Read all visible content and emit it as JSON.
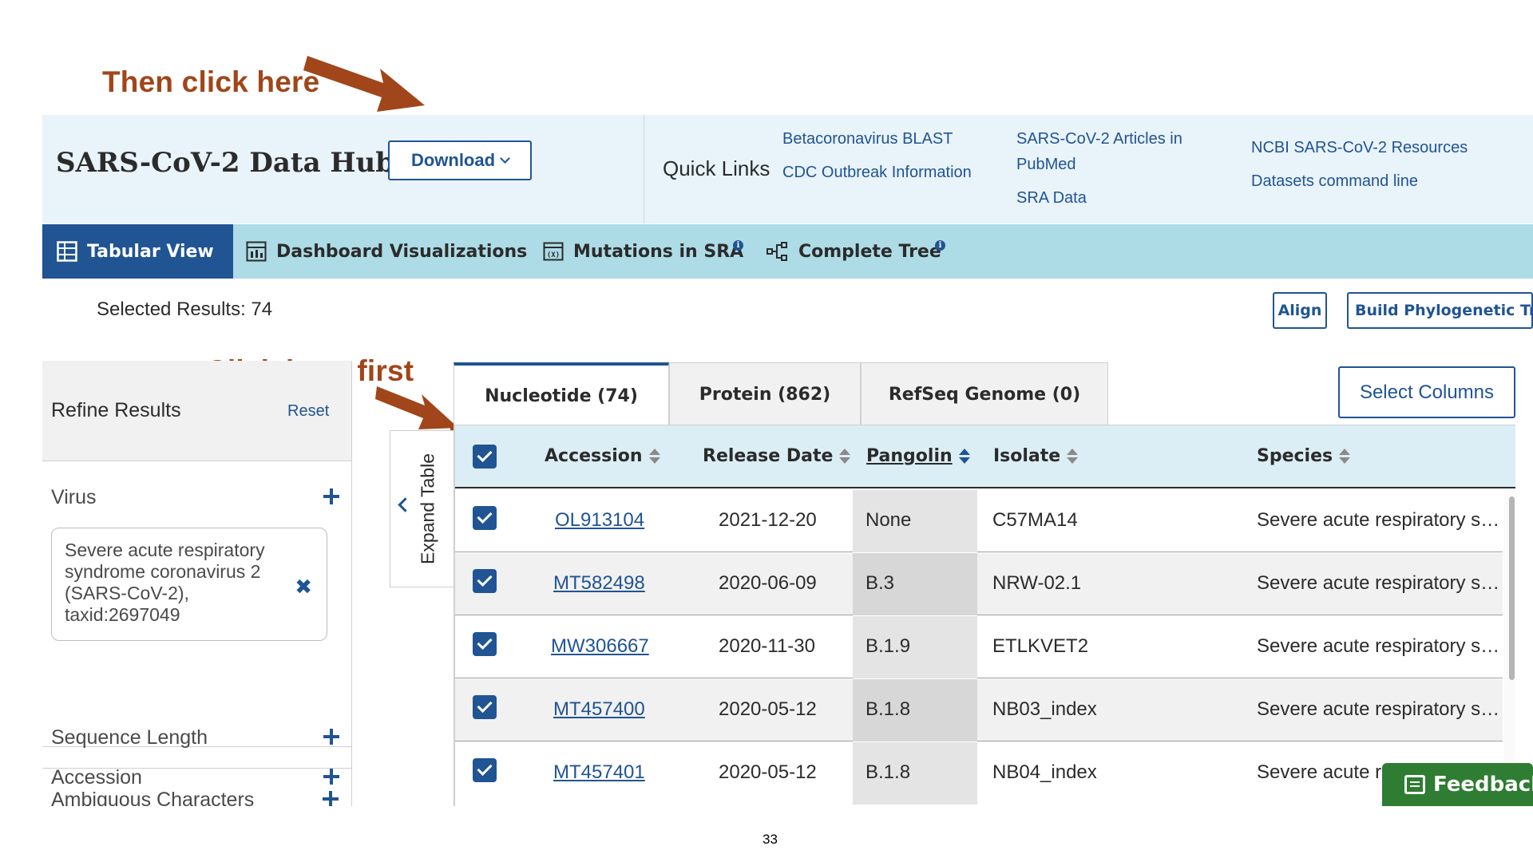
{
  "annotations": {
    "top": "Then click here",
    "left": "Click here first"
  },
  "header": {
    "title": "SARS-CoV-2 Data Hub",
    "download_label": "Download",
    "quick_links_label": "Quick Links",
    "quick_links": [
      "Betacoronavirus BLAST",
      "CDC Outbreak Information",
      "SARS-CoV-2 Articles in",
      "PubMed",
      "SRA Data",
      "NCBI SARS-CoV-2 Resources",
      "Datasets command line"
    ]
  },
  "view_tabs": [
    "Tabular View",
    "Dashboard Visualizations",
    "Mutations in SRA",
    "Complete Tree"
  ],
  "selected_results": "Selected Results: 74",
  "actions": {
    "align": "Align",
    "phylo": "Build Phylogenetic Tree"
  },
  "refine": {
    "title": "Refine Results",
    "reset": "Reset",
    "facets": [
      "Virus",
      "Accession",
      "Sequence Length",
      "Ambiguous Characters"
    ],
    "virus_filter": "Severe acute respiratory syndrome coronavirus 2 (SARS-CoV-2), taxid:2697049"
  },
  "expand_label": "Expand Table",
  "result_tabs": [
    "Nucleotide (74)",
    "Protein (862)",
    "RefSeq Genome (0)"
  ],
  "select_columns": "Select Columns",
  "table": {
    "columns": [
      "Accession",
      "Release Date",
      "Pangolin",
      "Isolate",
      "Species"
    ],
    "rows": [
      {
        "accession": "OL913104",
        "date": "2021-12-20",
        "pangolin": "None",
        "isolate": "C57MA14",
        "species": "Severe acute respiratory s…",
        "checked": true
      },
      {
        "accession": "MT582498",
        "date": "2020-06-09",
        "pangolin": "B.3",
        "isolate": "NRW-02.1",
        "species": "Severe acute respiratory s…",
        "checked": true
      },
      {
        "accession": "MW306667",
        "date": "2020-11-30",
        "pangolin": "B.1.9",
        "isolate": "ETLKVET2",
        "species": "Severe acute respiratory s…",
        "checked": true
      },
      {
        "accession": "MT457400",
        "date": "2020-05-12",
        "pangolin": "B.1.8",
        "isolate": "NB03_index",
        "species": "Severe acute respiratory s…",
        "checked": true
      },
      {
        "accession": "MT457401",
        "date": "2020-05-12",
        "pangolin": "B.1.8",
        "isolate": "NB04_index",
        "species": "Severe acute re",
        "checked": true
      }
    ]
  },
  "feedback": "Feedback",
  "page_number": "33",
  "colors": {
    "annotation": "#a0461a",
    "primary": "#205493",
    "header_bg": "#e9f3fa",
    "tabs_bg": "#addbe6",
    "feedback": "#2e7d32"
  }
}
